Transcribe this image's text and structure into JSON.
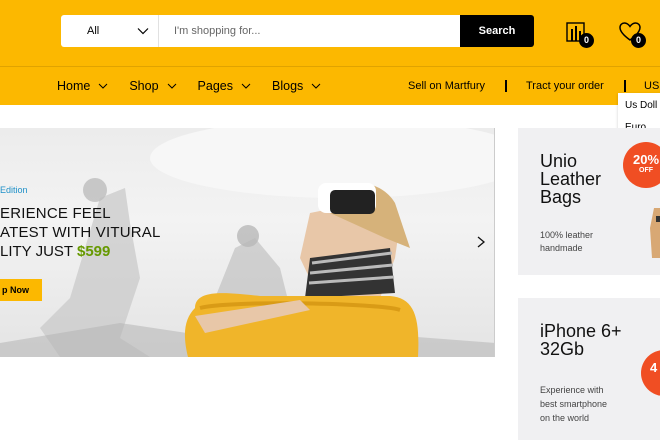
{
  "search": {
    "category": "All",
    "placeholder": "I'm shopping for...",
    "button": "Search"
  },
  "header": {
    "compare_count": "0",
    "wishlist_count": "0"
  },
  "nav": {
    "items": [
      "Home",
      "Shop",
      "Pages",
      "Blogs"
    ],
    "sell": "Sell on Martfury",
    "track": "Tract your order",
    "currency": "US"
  },
  "currency_menu": [
    "Us Doll",
    "Euro"
  ],
  "banner": {
    "edition": "Edition",
    "line1": "ERIENCE FEEL",
    "line2": "ATEST WITH VITURAL",
    "line3": "LITY JUST ",
    "price": "$599",
    "cta": "p Now"
  },
  "promos": [
    {
      "title_lines": [
        "Unio",
        "Leather",
        "Bags"
      ],
      "desc_lines": [
        "100% leather",
        "handmade"
      ],
      "discount": "20%",
      "off": "OFF"
    },
    {
      "title_lines": [
        "iPhone 6+",
        "32Gb"
      ],
      "desc_lines": [
        "Experience with",
        "best smartphone",
        "on the world"
      ],
      "discount": "4"
    }
  ],
  "colors": {
    "brand": "#fcb800",
    "price": "#669900",
    "discount": "#f04e23",
    "edition": "#1e90c8"
  }
}
